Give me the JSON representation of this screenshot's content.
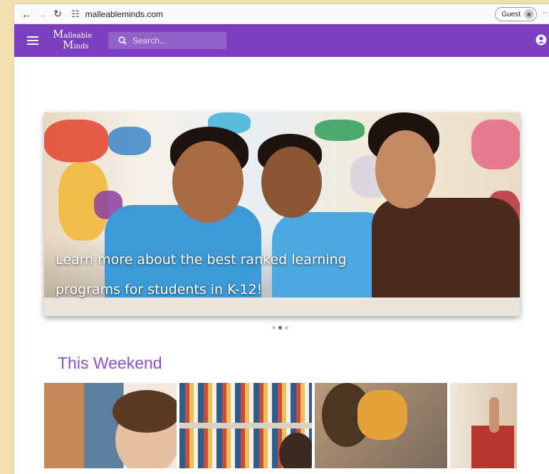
{
  "browser": {
    "url": "malleableminds.com",
    "profile_label": "Guest",
    "more_label": "···"
  },
  "header": {
    "logo": {
      "line1_initial": "M",
      "line1_rest": "alleable",
      "line2_initial": "M",
      "line2_rest": "inds"
    },
    "search_placeholder": "Search...",
    "menu_icon": "hamburger-menu-icon",
    "account_icon": "account-circle-icon",
    "color": "#7b3fbf"
  },
  "hero": {
    "caption": "Learn more about the best ranked learning programs for students in K-12!",
    "slides": 3,
    "active_slide": 2
  },
  "section": {
    "title": "This Weekend",
    "title_color": "#8c4fc6"
  }
}
